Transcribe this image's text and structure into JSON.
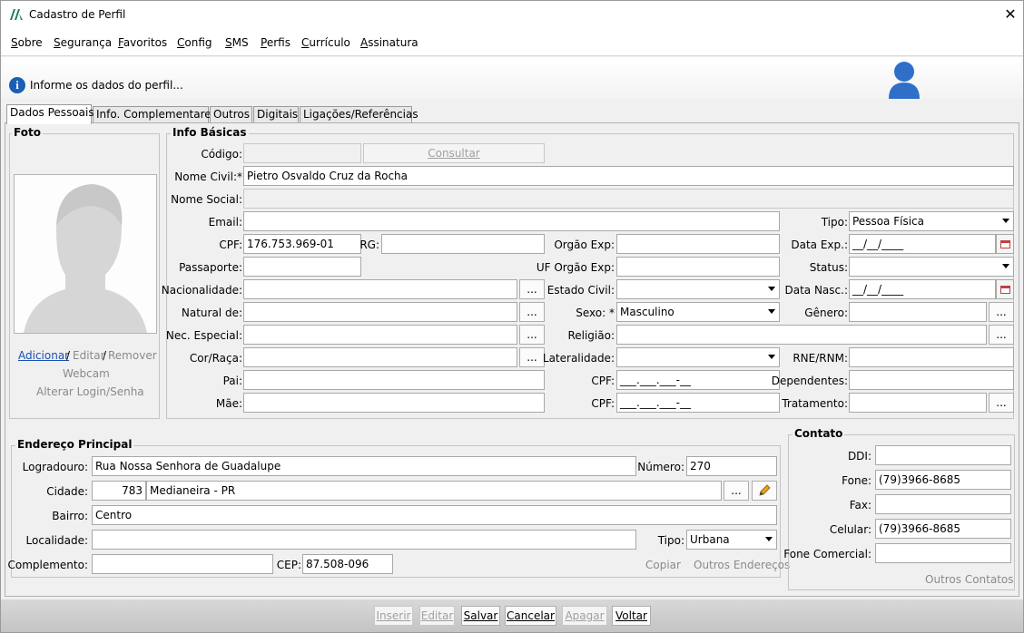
{
  "window": {
    "title": "Cadastro de Perfil",
    "close": "✕"
  },
  "menu": [
    "Sobre",
    "Segurança",
    "Favoritos",
    "Config",
    "SMS",
    "Perfis",
    "Currículo",
    "Assinatura"
  ],
  "banner": {
    "message": "Informe os dados do perfil...",
    "info_icon": "i"
  },
  "tabs": [
    "Dados Pessoais",
    "Info. Complementares",
    "Outros",
    "Digitais",
    "Ligações/Referências"
  ],
  "foto": {
    "legend": "Foto",
    "adicionar": "Adicionar",
    "sep1": "/",
    "editar": "Editar",
    "sep2": "/",
    "remover": "Remover",
    "webcam": "Webcam",
    "alterar_login": "Alterar Login/Senha"
  },
  "info_basicas": {
    "legend": "Info Básicas",
    "codigo_label": "Código:",
    "codigo_value": "",
    "consultar": "Consultar",
    "nome_civil_label": "Nome Civil:*",
    "nome_civil_value": "Pietro Osvaldo Cruz da Rocha",
    "nome_social_label": "Nome Social:",
    "email_label": "Email:",
    "tipo_label": "Tipo:",
    "tipo_value": "Pessoa Física",
    "cpf_label": "CPF:",
    "cpf_value": "176.753.969-01",
    "rg_label": "RG:",
    "orgao_exp_label": "Orgão Exp:",
    "data_exp_label": "Data Exp.:",
    "data_exp_value": "__/__/____",
    "passaporte_label": "Passaporte:",
    "uf_orgao_label": "UF Orgão Exp:",
    "status_label": "Status:",
    "nacionalidade_label": "Nacionalidade:",
    "estado_civil_label": "Estado Civil:",
    "data_nasc_label": "Data Nasc.:",
    "data_nasc_value": "__/__/____",
    "natural_label": "Natural de:",
    "sexo_label": "Sexo: *",
    "sexo_value": "Masculino",
    "genero_label": "Gênero:",
    "nec_label": "Nec. Especial:",
    "religiao_label": "Religião:",
    "cor_label": "Cor/Raça:",
    "lateralidade_label": "Lateralidade:",
    "rne_label": "RNE/RNM:",
    "pai_label": "Pai:",
    "cpf_pai_label": "CPF:",
    "cpf_pai_value": "___.___.___-__",
    "dependentes_label": "Dependentes:",
    "mae_label": "Mãe:",
    "cpf_mae_label": "CPF:",
    "cpf_mae_value": "___.___.___-__",
    "tratamento_label": "Tratamento:",
    "ellipsis": "..."
  },
  "endereco": {
    "legend": "Endereço Principal",
    "logradouro_label": "Logradouro:",
    "logradouro_value": "Rua Nossa Senhora de Guadalupe",
    "numero_label": "Número:",
    "numero_value": "270",
    "cidade_label": "Cidade:",
    "cidade_code": "783",
    "cidade_value": "Medianeira - PR",
    "bairro_label": "Bairro:",
    "bairro_value": "Centro",
    "localidade_label": "Localidade:",
    "tipo_label": "Tipo:",
    "tipo_value": "Urbana",
    "complemento_label": "Complemento:",
    "cep_label": "CEP:",
    "cep_value": "87.508-096",
    "copiar": "Copiar",
    "outros_enderecos": "Outros Endereços"
  },
  "contato": {
    "legend": "Contato",
    "ddi_label": "DDI:",
    "fone_label": "Fone:",
    "fone_value": "(79)3966-8685",
    "fax_label": "Fax:",
    "celular_label": "Celular:",
    "celular_value": "(79)3966-8685",
    "fone_comercial_label": "Fone Comercial:",
    "outros_contatos": "Outros Contatos"
  },
  "actions": [
    "Inserir",
    "Editar",
    "Salvar",
    "Cancelar",
    "Apagar",
    "Voltar"
  ],
  "colors": {
    "info_blue": "#1a5fb4",
    "user_icon": "#2f6fc8",
    "disabled_text": "#a0a0a0"
  }
}
